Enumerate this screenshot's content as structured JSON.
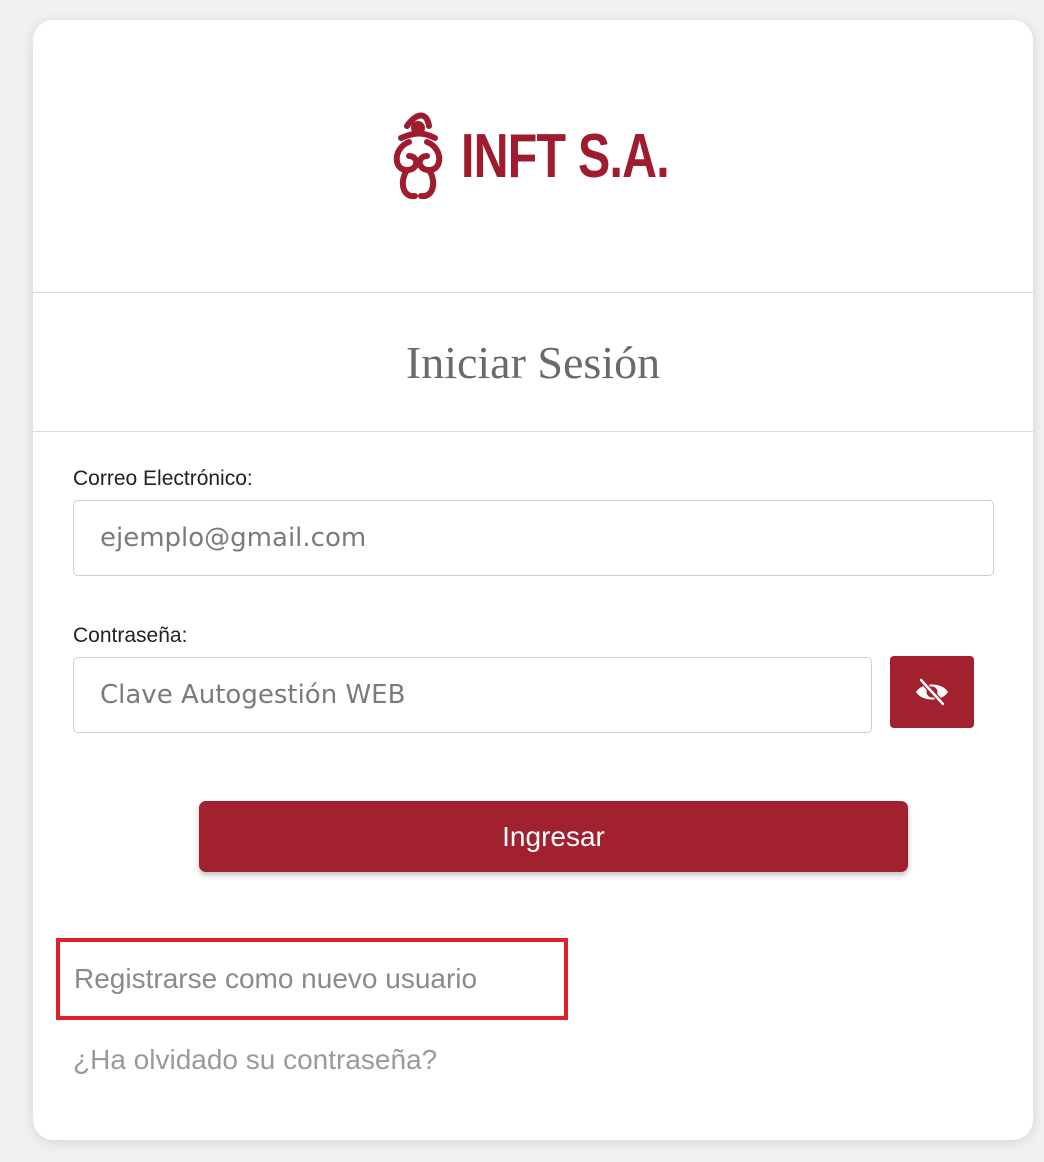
{
  "brand": {
    "logo_text": "INFT S.A.",
    "color": "#9e1c2d"
  },
  "form": {
    "title": "Iniciar Sesión",
    "email": {
      "label": "Correo Electrónico:",
      "placeholder": "ejemplo@gmail.com",
      "value": ""
    },
    "password": {
      "label": "Contraseña:",
      "placeholder": "Clave Autogestión WEB",
      "value": "",
      "toggle_icon": "eye-slash-icon"
    },
    "submit_label": "Ingresar"
  },
  "links": {
    "register": "Registrarse como nuevo usuario",
    "forgot": "¿Ha olvidado su contraseña?"
  },
  "colors": {
    "accent": "#a1212e",
    "highlight_border": "#e0202a"
  }
}
